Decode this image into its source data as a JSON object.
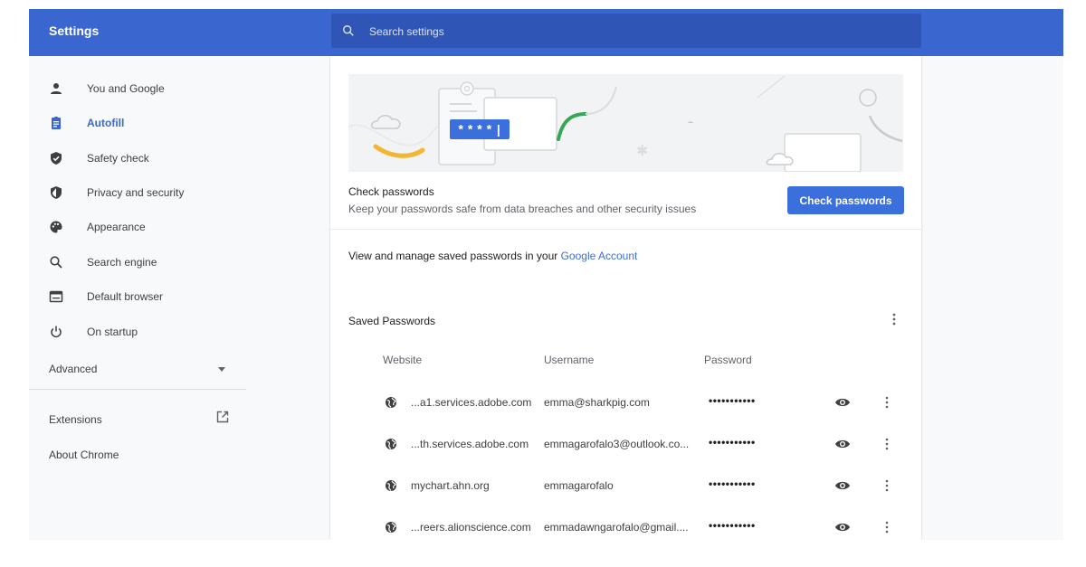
{
  "header": {
    "title": "Settings",
    "search_placeholder": "Search settings"
  },
  "sidebar": {
    "items": [
      {
        "label": "You and Google",
        "icon": "person-icon",
        "active": false
      },
      {
        "label": "Autofill",
        "icon": "clipboard-icon",
        "active": true
      },
      {
        "label": "Safety check",
        "icon": "shield-check-icon",
        "active": false
      },
      {
        "label": "Privacy and security",
        "icon": "shield-icon",
        "active": false
      },
      {
        "label": "Appearance",
        "icon": "palette-icon",
        "active": false
      },
      {
        "label": "Search engine",
        "icon": "search-icon",
        "active": false
      },
      {
        "label": "Default browser",
        "icon": "browser-icon",
        "active": false
      },
      {
        "label": "On startup",
        "icon": "power-icon",
        "active": false
      }
    ],
    "advanced_label": "Advanced",
    "extensions_label": "Extensions",
    "about_label": "About Chrome"
  },
  "banner": {
    "password_mask": "****|"
  },
  "check": {
    "title": "Check passwords",
    "subtitle": "Keep your passwords safe from data breaches and other security issues",
    "button_label": "Check passwords"
  },
  "manage": {
    "text": "View and manage saved passwords in your ",
    "link_label": "Google Account"
  },
  "saved": {
    "title": "Saved Passwords",
    "columns": {
      "website": "Website",
      "username": "Username",
      "password": "Password"
    },
    "rows": [
      {
        "website": "...a1.services.adobe.com",
        "username": "emma@sharkpig.com",
        "password": "•••••••••••"
      },
      {
        "website": "...th.services.adobe.com",
        "username": "emmagarofalo3@outlook.co...",
        "password": "•••••••••••"
      },
      {
        "website": "mychart.ahn.org",
        "username": "emmagarofalo",
        "password": "•••••••••••"
      },
      {
        "website": "...reers.alionscience.com",
        "username": "emmadawngarofalo@gmail....",
        "password": "•••••••••••"
      }
    ]
  },
  "colors": {
    "header": "#3a67cf",
    "search_box": "#2f56b6",
    "accent": "#3a6fdc",
    "sidebar_bg": "#f8f9fa"
  }
}
